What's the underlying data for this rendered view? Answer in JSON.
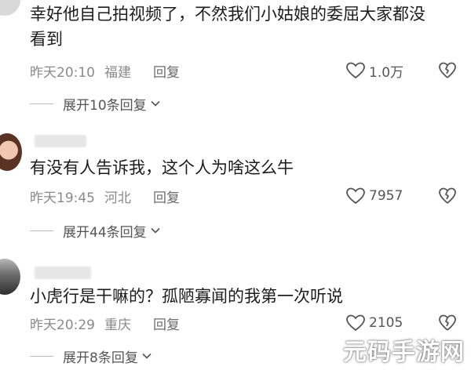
{
  "comments": [
    {
      "text": "幸好他自己拍视频了，不然我们小姑娘的委屈大家都没看到",
      "time": "昨天20:10",
      "location": "福建",
      "reply_label": "回复",
      "likes": "1.0万",
      "expand_label": "展开10条回复"
    },
    {
      "text": "有没有人告诉我，这个人为啥这么牛",
      "time": "昨天19:45",
      "location": "河北",
      "reply_label": "回复",
      "likes": "7957",
      "expand_label": "展开44条回复"
    },
    {
      "text": "小虎行是干嘛的？孤陋寡闻的我第一次听说",
      "time": "昨天20:29",
      "location": "重庆",
      "reply_label": "回复",
      "likes": "2105",
      "expand_label": "展开8条回复"
    }
  ],
  "watermark": "元码手游网"
}
